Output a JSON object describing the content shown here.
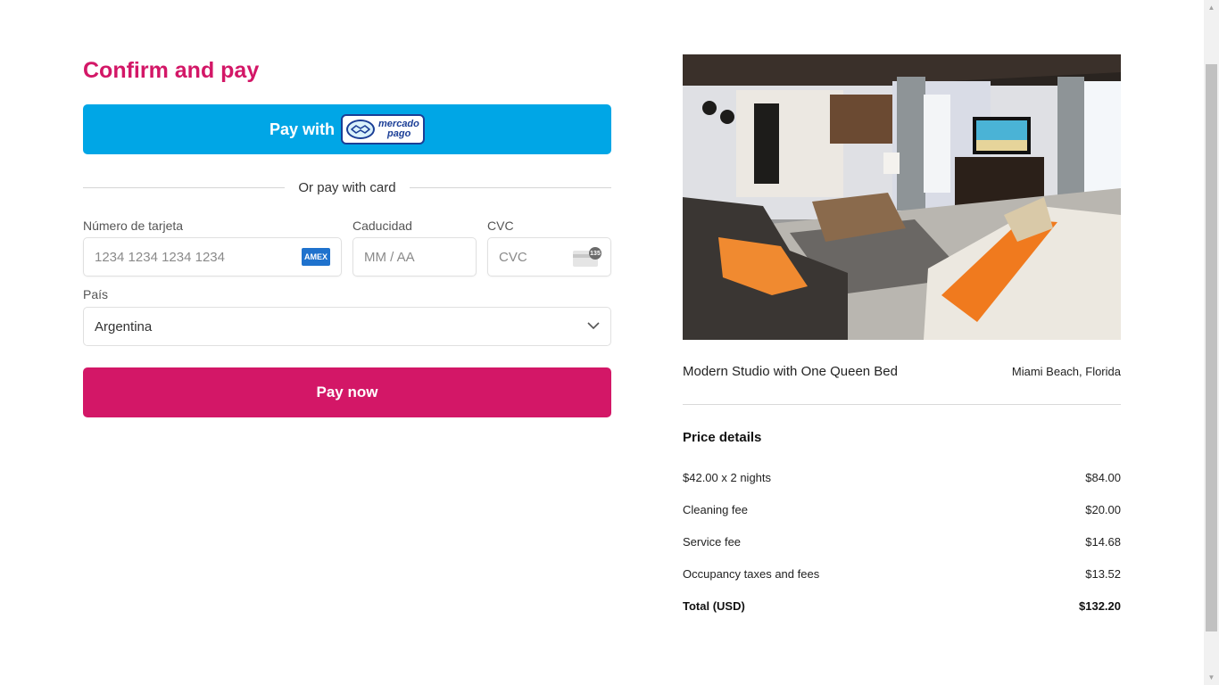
{
  "checkout": {
    "title": "Confirm and pay",
    "mercadopago": {
      "pay_with_label": "Pay with",
      "logo_word_1": "mercado",
      "logo_word_2": "pago"
    },
    "divider_label": "Or pay with card",
    "card_number": {
      "label": "Número de tarjeta",
      "placeholder": "1234 1234 1234 1234",
      "brand_icon": "amex-card-icon",
      "brand_text": "AMEX"
    },
    "expiry": {
      "label": "Caducidad",
      "placeholder": "MM / AA"
    },
    "cvc": {
      "label": "CVC",
      "placeholder": "CVC",
      "icon": "cvc-card-icon",
      "badge_text": "135"
    },
    "country": {
      "label": "País",
      "selected": "Argentina",
      "icon": "chevron-down-icon"
    },
    "pay_now_label": "Pay now"
  },
  "listing": {
    "name": "Modern Studio with One Queen Bed",
    "location": "Miami Beach, Florida"
  },
  "price_details": {
    "title": "Price details",
    "rows": [
      {
        "label": "$42.00 x 2 nights",
        "amount": "$84.00"
      },
      {
        "label": "Cleaning fee",
        "amount": "$20.00"
      },
      {
        "label": "Service fee",
        "amount": "$14.68"
      },
      {
        "label": "Occupancy taxes and fees",
        "amount": "$13.52"
      }
    ],
    "total": {
      "label": "Total (USD)",
      "amount": "$132.20"
    }
  },
  "colors": {
    "brand_pink": "#d31767",
    "mercadopago_blue": "#00a6e6"
  }
}
